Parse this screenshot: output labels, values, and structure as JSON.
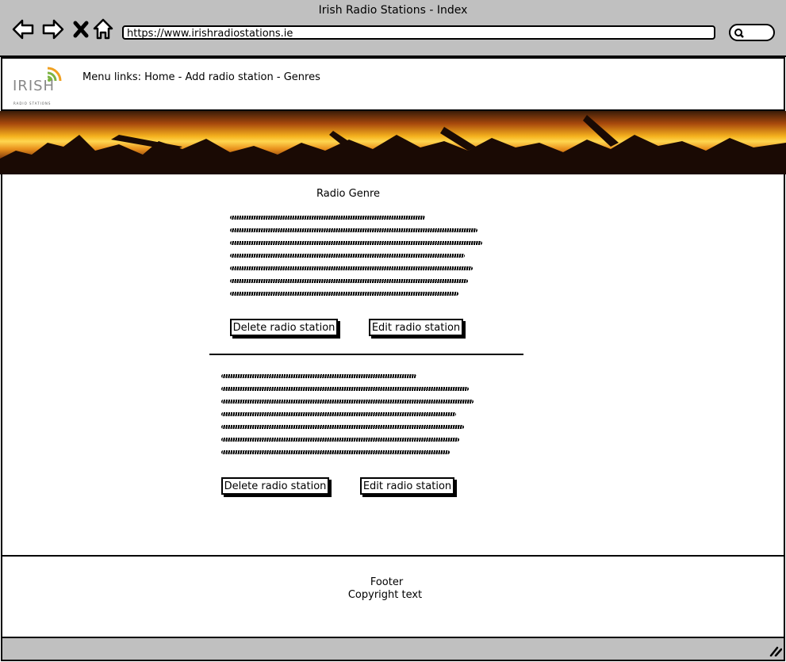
{
  "window": {
    "title": "Irish Radio Stations - Index"
  },
  "browser": {
    "url": "https://www.irishradiostations.ie",
    "back_icon": "back-arrow-icon",
    "forward_icon": "forward-arrow-icon",
    "close_icon": "close-x-icon",
    "home_icon": "home-icon",
    "search_icon": "search-icon"
  },
  "header": {
    "logo_text": "IRISH",
    "logo_subtext": "RADIO STATIONS",
    "menu_text": "Menu links: Home - Add radio station - Genres"
  },
  "content": {
    "section_title": "Radio Genre",
    "stations": [
      {
        "delete_label": "Delete radio station",
        "edit_label": "Edit radio station"
      },
      {
        "delete_label": "Delete radio station",
        "edit_label": "Edit radio station"
      }
    ]
  },
  "footer": {
    "title": "Footer",
    "copyright": "Copyright text"
  },
  "colors": {
    "chrome": "#c0c0c0",
    "logo_green": "#7cb342",
    "logo_orange": "#f0a020"
  }
}
